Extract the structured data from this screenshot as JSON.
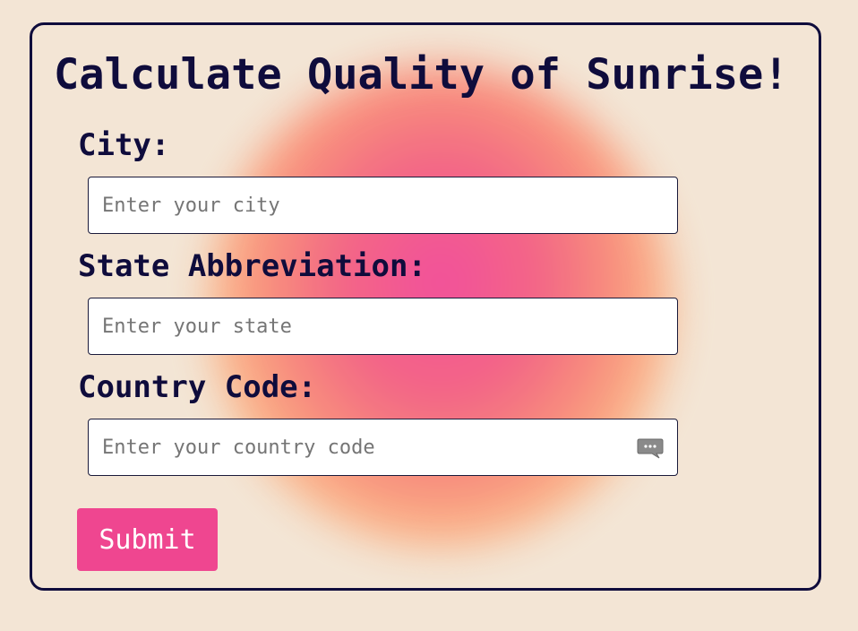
{
  "form": {
    "title": "Calculate Quality of Sunrise!",
    "fields": [
      {
        "label": "City:",
        "placeholder": "Enter your city",
        "value": ""
      },
      {
        "label": "State Abbreviation:",
        "placeholder": "Enter your state",
        "value": ""
      },
      {
        "label": "Country Code:",
        "placeholder": "Enter your country code",
        "value": ""
      }
    ],
    "submit_label": "Submit"
  },
  "icons": {
    "country_field_icon": "chat-bubble-icon"
  },
  "colors": {
    "background": "#f3e5d5",
    "ink": "#0f0c3c",
    "accent": "#ef4690",
    "blob_top": "#f2489a",
    "blob_mid": "#f98a78",
    "blob_bottom": "#fbb486"
  }
}
